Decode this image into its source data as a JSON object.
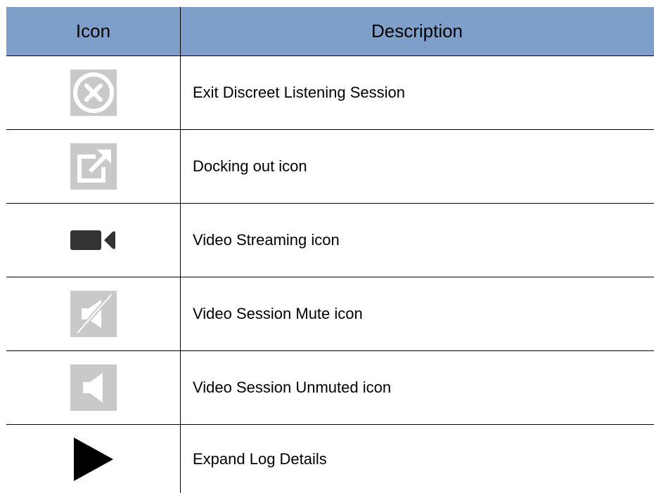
{
  "table": {
    "header": {
      "icon_col": "Icon",
      "description_col": "Description"
    },
    "rows": [
      {
        "icon": "exit-circle-icon",
        "description": "Exit Discreet Listening Session"
      },
      {
        "icon": "dock-out-icon",
        "description": "Docking out icon"
      },
      {
        "icon": "video-camera-icon",
        "description": "Video Streaming icon"
      },
      {
        "icon": "speaker-muted-icon",
        "description": "Video Session Mute icon"
      },
      {
        "icon": "speaker-unmuted-icon",
        "description": "Video Session Unmuted icon"
      },
      {
        "icon": "play-triangle-icon",
        "description": "Expand Log Details"
      }
    ]
  },
  "colors": {
    "header_bg": "#7f9fcb",
    "icon_gray": "#c9c9c9",
    "icon_dark": "#333333",
    "icon_black": "#000000"
  }
}
